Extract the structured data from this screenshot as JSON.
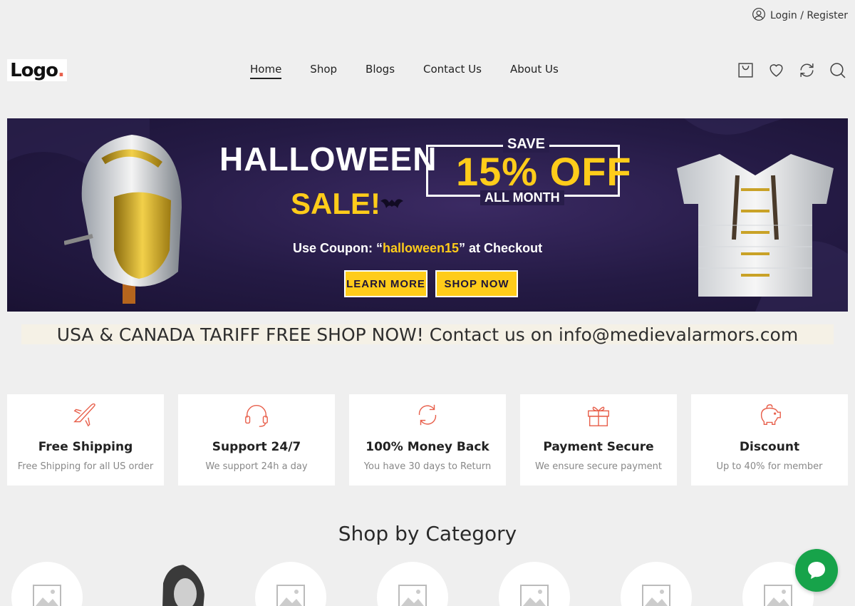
{
  "topbar": {
    "login_label": "Login / Register"
  },
  "logo": {
    "text": "Logo",
    "dot": "."
  },
  "nav": {
    "items": [
      {
        "label": "Home",
        "active": true
      },
      {
        "label": "Shop"
      },
      {
        "label": "Blogs"
      },
      {
        "label": "Contact Us"
      },
      {
        "label": "About Us"
      }
    ]
  },
  "header_icons": [
    "cart-icon",
    "heart-icon",
    "compare-icon",
    "search-icon"
  ],
  "banner": {
    "headline": "HALLOWEEN",
    "sale": "SALE!",
    "save": "SAVE",
    "discount": "15% OFF",
    "period": "ALL MONTH",
    "coupon_prefix": "Use Coupon: “",
    "coupon_code": "halloween15",
    "coupon_suffix": "” at Checkout",
    "learn_more": "LEARN MORE",
    "shop_now": "SHOP NOW"
  },
  "tariff_notice": "USA & CANADA TARIFF FREE SHOP NOW! Contact us on info@medievalarmors.com",
  "features": [
    {
      "icon": "airplane-icon",
      "title": "Free Shipping",
      "subtitle": "Free Shipping for all US order"
    },
    {
      "icon": "headset-icon",
      "title": "Support 24/7",
      "subtitle": "We support 24h a day"
    },
    {
      "icon": "refresh-icon",
      "title": "100% Money Back",
      "subtitle": "You have 30 days to Return"
    },
    {
      "icon": "gift-icon",
      "title": "Payment Secure",
      "subtitle": "We ensure secure payment"
    },
    {
      "icon": "piggy-bank-icon",
      "title": "Discount",
      "subtitle": "Up to 40% for member"
    }
  ],
  "category_section": {
    "title": "Shop by Category"
  },
  "colors": {
    "accent": "#e8604c",
    "banner_yellow": "#ffcc1a",
    "chat_green": "#17a34a"
  }
}
